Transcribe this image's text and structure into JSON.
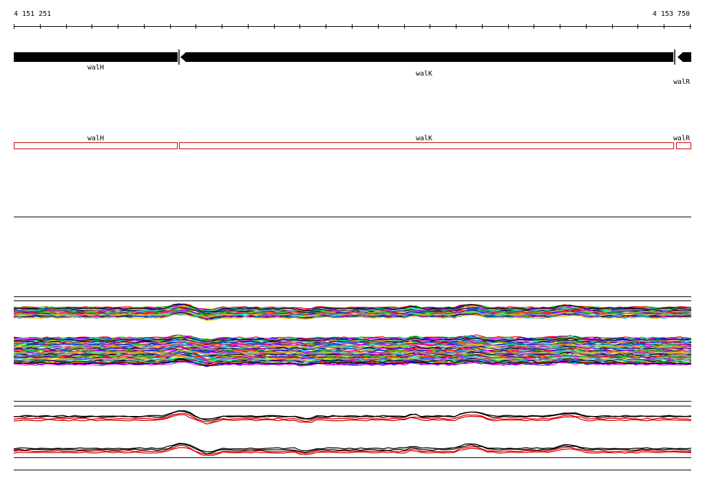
{
  "coordinates": {
    "start_label": "4 151 251",
    "end_label": "4 153 750",
    "start": 4151251,
    "end": 4153750,
    "tick_count": 26
  },
  "gene_track": {
    "genes": [
      {
        "name": "walH",
        "strand": "-"
      },
      {
        "name": "walK",
        "strand": "-"
      },
      {
        "name": "walR",
        "strand": "-"
      }
    ]
  },
  "feature_track": {
    "features": [
      {
        "name": "walH"
      },
      {
        "name": "walK"
      },
      {
        "name": "walR"
      }
    ]
  },
  "colors": {
    "gene_fill": "#000000",
    "feature_outline": "#cc0000",
    "track_border": "#000000",
    "background": "#ffffff"
  },
  "expression_track_1": {
    "palette": [
      "#ff0000",
      "#00cc00",
      "#0000ff",
      "#ff00ff",
      "#00cccc",
      "#cccc00",
      "#ff8800",
      "#8800ff",
      "#00ff88",
      "#888888",
      "#000000",
      "#aa00aa",
      "#0088ff",
      "#ffcc00"
    ]
  },
  "expression_track_2": {
    "series_colors": [
      "#000000",
      "#dd0000"
    ]
  }
}
